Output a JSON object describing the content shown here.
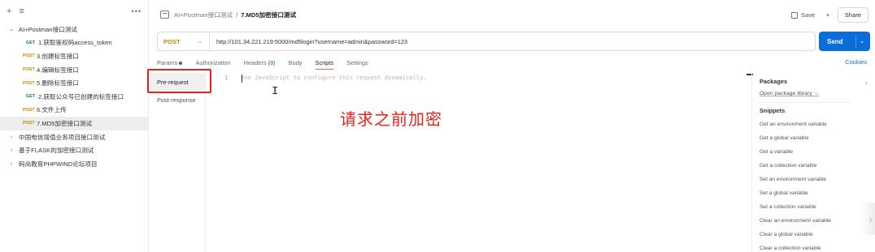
{
  "sidebar": {
    "top": {
      "add_icon": "+",
      "filter_icon": "≡",
      "more_icon": "•••"
    },
    "tree": [
      {
        "type": "folder",
        "expanded": true,
        "label": "AI+Postman接口测试",
        "level": 0
      },
      {
        "type": "request",
        "method": "GET",
        "label": "1.获取鉴权码access_token",
        "level": 2
      },
      {
        "type": "request",
        "method": "POST",
        "label": "3.创建标签接口",
        "level": 1
      },
      {
        "type": "request",
        "method": "POST",
        "label": "4.编辑标签接口",
        "level": 1
      },
      {
        "type": "request",
        "method": "POST",
        "label": "5.删除标签接口",
        "level": 1
      },
      {
        "type": "request",
        "method": "GET",
        "label": "2.获取公众号已创建的标签接口",
        "level": 2
      },
      {
        "type": "request",
        "method": "POST",
        "label": "6.文件上传",
        "level": 1
      },
      {
        "type": "request",
        "method": "POST",
        "label": "7.MD5加密接口测试",
        "level": 1,
        "selected": true
      },
      {
        "type": "folder",
        "expanded": false,
        "label": "中国电信增值业务项目接口测试",
        "level": 0
      },
      {
        "type": "folder",
        "expanded": false,
        "label": "基于FLASK的加密接口测试",
        "level": 0
      },
      {
        "type": "folder",
        "expanded": false,
        "label": "码尚教育PHPWIND论坛项目",
        "level": 0
      }
    ]
  },
  "header": {
    "breadcrumb_parent": "AI+Postman接口测试",
    "breadcrumb_sep": "/",
    "breadcrumb_current": "7.MD5加密接口测试",
    "save_label": "Save",
    "share_label": "Share"
  },
  "request": {
    "method": "POST",
    "url": "http://101.34.221.219:5000/md5login?username=admin&password=123",
    "send_label": "Send"
  },
  "tabs": {
    "params": "Params",
    "authorization": "Authorization",
    "headers": "Headers",
    "headers_count": "(8)",
    "body": "Body",
    "scripts": "Scripts",
    "settings": "Settings",
    "cookies": "Cookies"
  },
  "scripts": {
    "pre_request": "Pre-request",
    "post_response": "Post-response",
    "line_number": "1",
    "placeholder": "Use JavaScript to configure this request dynamically."
  },
  "annotation": "请求之前加密",
  "right_panel": {
    "packages_title": "Packages",
    "open_package_library": "Open package library →",
    "snippets_title": "Snippets",
    "snippets": [
      "Get an environment variable",
      "Get a global variable",
      "Get a variable",
      "Get a collection variable",
      "Set an environment variable",
      "Set a global variable",
      "Set a collection variable",
      "Clear an environment variable",
      "Clear a global variable",
      "Clear a collection variable"
    ]
  },
  "colors": {
    "accent_send": "#0a6ed8",
    "method_post": "#c48a00",
    "method_get": "#0a8a3e",
    "annotation_red": "#e8221b"
  }
}
